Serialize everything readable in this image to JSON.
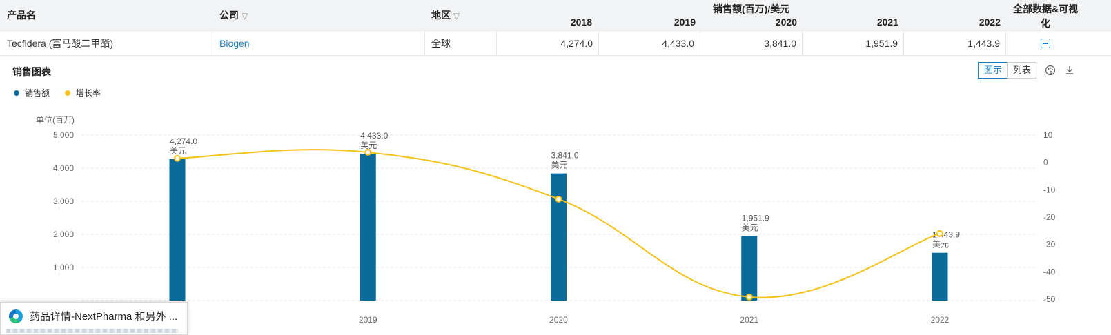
{
  "table": {
    "headers": {
      "product": "产品名",
      "company": "公司",
      "region": "地区",
      "sales_group": "销售额(百万)/美元",
      "years": [
        "2018",
        "2019",
        "2020",
        "2021",
        "2022"
      ],
      "all_data_line1": "全部数据&可视",
      "all_data_line2": "化"
    },
    "row": {
      "product": "Tecfidera (富马酸二甲酯)",
      "company": "Biogen",
      "region": "全球",
      "values": [
        "4,274.0",
        "4,433.0",
        "3,841.0",
        "1,951.9",
        "1,443.9"
      ]
    }
  },
  "panel": {
    "title": "销售图表",
    "toggle_chart": "图示",
    "toggle_list": "列表",
    "palette_icon": "palette-icon",
    "download_icon": "download-icon"
  },
  "colors": {
    "bar": "#0a6a9a",
    "line": "#f5c218",
    "accent": "#1e7fc1"
  },
  "chart_data": {
    "type": "bar",
    "categories": [
      "2018",
      "2019",
      "2020",
      "2021",
      "2022"
    ],
    "series": [
      {
        "name": "销售额",
        "axis": "left",
        "values": [
          4274.0,
          4433.0,
          3841.0,
          1951.9,
          1443.9
        ]
      },
      {
        "name": "增长率",
        "axis": "right",
        "type": "line",
        "values": [
          1.5,
          3.7,
          -13.4,
          -49.2,
          -26.0
        ]
      }
    ],
    "data_labels": [
      "4,274.0",
      "4,433.0",
      "3,841.0",
      "1,951.9",
      "1,443.9"
    ],
    "data_label_unit": "美元",
    "left_axis": {
      "label": "单位(百万)",
      "ticks": [
        "5,000",
        "4,000",
        "3,000",
        "2,000",
        "1,000"
      ],
      "ylim": [
        0,
        5000
      ]
    },
    "right_axis": {
      "ticks": [
        "10",
        "0",
        "-10",
        "-20",
        "-30",
        "-40",
        "-50"
      ],
      "ylim": [
        -50,
        10
      ]
    },
    "grid": true,
    "legend": "top-left"
  },
  "taskbar_preview": {
    "title": "药品详情-NextPharma 和另外 ..."
  }
}
